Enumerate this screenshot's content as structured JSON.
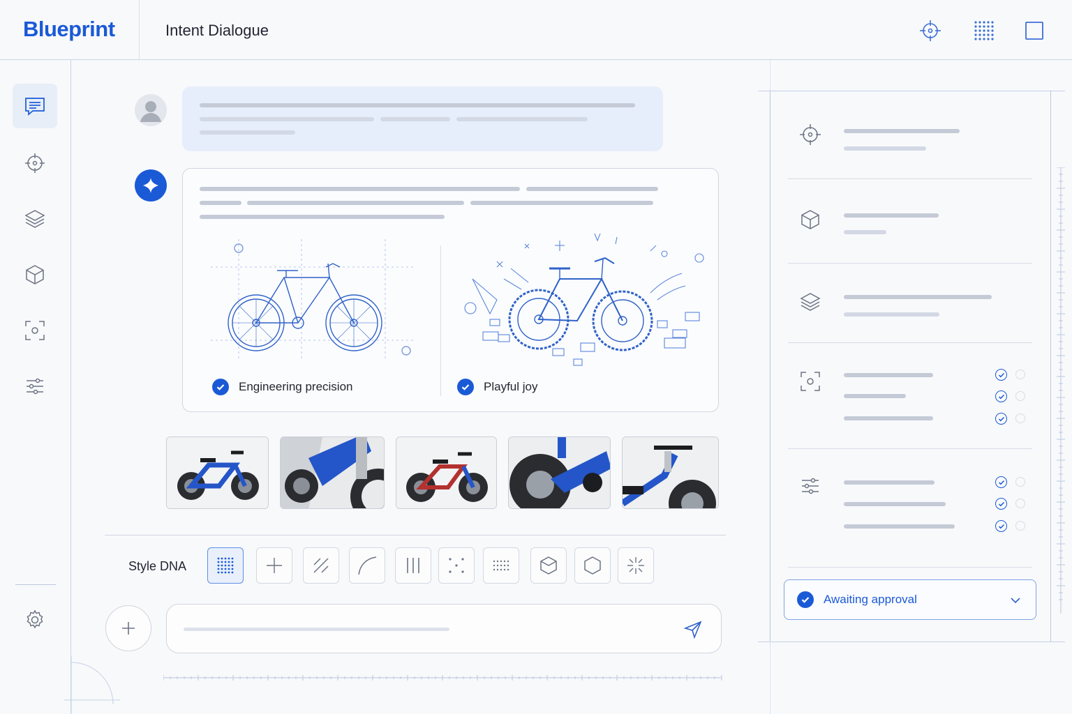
{
  "app": {
    "brand": "Blueprint",
    "title": "Intent Dialogue"
  },
  "topbar": {
    "icons": [
      "target-icon",
      "grid-icon",
      "square-icon"
    ]
  },
  "sidebar": {
    "items": [
      "chat-icon",
      "target-icon",
      "layers-icon",
      "cube-icon",
      "focus-icon",
      "sliders-icon"
    ],
    "footer": "gear-icon",
    "active": "chat-icon"
  },
  "conversation": {
    "options": [
      {
        "label": "Engineering precision",
        "checked": true
      },
      {
        "label": "Playful joy",
        "checked": true
      }
    ]
  },
  "style_dna": {
    "label": "Style DNA",
    "swatches": [
      "dot-grid-icon",
      "crosshair-icon",
      "hatch-icon",
      "curve-icon",
      "lines-icon",
      "scatter-dots-icon",
      "small-dot-grid-icon",
      "hex-cube-icon",
      "hexagon-icon",
      "burst-icon"
    ],
    "active": 0
  },
  "composer": {
    "placeholder": ""
  },
  "status": {
    "label": "Awaiting approval"
  },
  "colors": {
    "accent": "#1a5ad6",
    "surface": "#f8f9fb",
    "bubble": "#e7eefb"
  }
}
